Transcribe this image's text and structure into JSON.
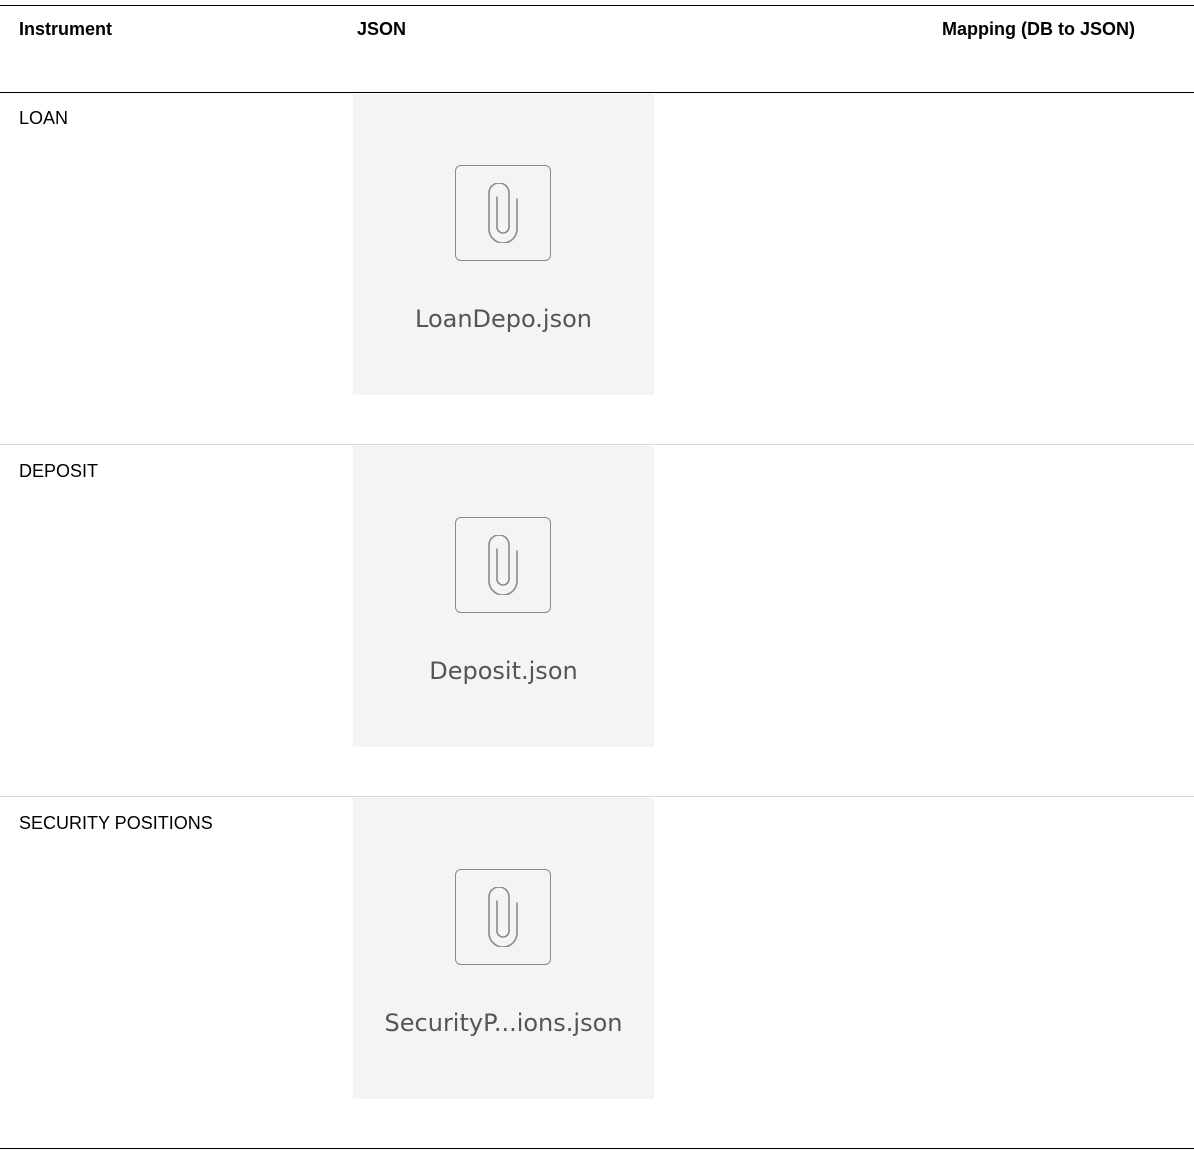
{
  "table": {
    "headers": {
      "instrument": "Instrument",
      "json": "JSON",
      "mapping": "Mapping (DB to JSON)"
    },
    "rows": [
      {
        "instrument": "LOAN",
        "attachment": {
          "file_name": "LoanDepo.json",
          "icon": "paperclip-icon"
        },
        "mapping": ""
      },
      {
        "instrument": "DEPOSIT",
        "attachment": {
          "file_name": "Deposit.json",
          "icon": "paperclip-icon"
        },
        "mapping": ""
      },
      {
        "instrument": "SECURITY POSITIONS",
        "attachment": {
          "file_name": "SecurityP...ions.json",
          "icon": "paperclip-icon"
        },
        "mapping": ""
      }
    ]
  },
  "colors": {
    "header_rule": "#000000",
    "row_rule": "#d9d9d9",
    "attachment_bg": "#f4f4f4",
    "attachment_border": "#8a8a8a",
    "attachment_text": "#555555"
  }
}
